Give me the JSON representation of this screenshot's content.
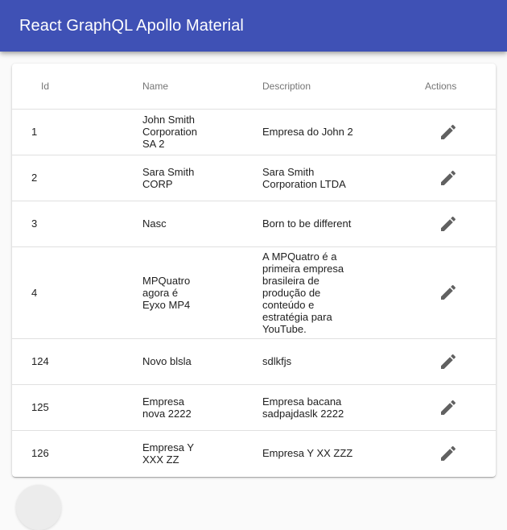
{
  "app": {
    "title": "React GraphQL Apollo Material",
    "primary_color": "#3f51b5"
  },
  "table": {
    "headers": {
      "id": "Id",
      "name": "Name",
      "description": "Description",
      "actions": "Actions"
    },
    "rows": [
      {
        "id": "1",
        "name": "John Smith Corporation SA 2",
        "description": "Empresa do John 2",
        "action_icon": "edit-icon"
      },
      {
        "id": "2",
        "name": "Sara Smith CORP",
        "description": "Sara Smith Corporation LTDA",
        "action_icon": "edit-icon"
      },
      {
        "id": "3",
        "name": "Nasc",
        "description": "Born to be different",
        "action_icon": "edit-icon"
      },
      {
        "id": "4",
        "name": "MPQuatro agora é Eyxo MP4",
        "description": "A MPQuatro é a primeira empresa brasileira de produção de conteúdo e estratégia para YouTube.",
        "action_icon": "edit-icon"
      },
      {
        "id": "124",
        "name": "Novo blsla",
        "description": "sdlkfjs",
        "action_icon": "edit-icon"
      },
      {
        "id": "125",
        "name": "Empresa nova 2222",
        "description": "Empresa bacana sadpajdaslk 2222",
        "action_icon": "edit-icon"
      },
      {
        "id": "126",
        "name": "Empresa Y XXX ZZ",
        "description": "Empresa Y XX ZZZ",
        "action_icon": "edit-icon"
      }
    ]
  }
}
